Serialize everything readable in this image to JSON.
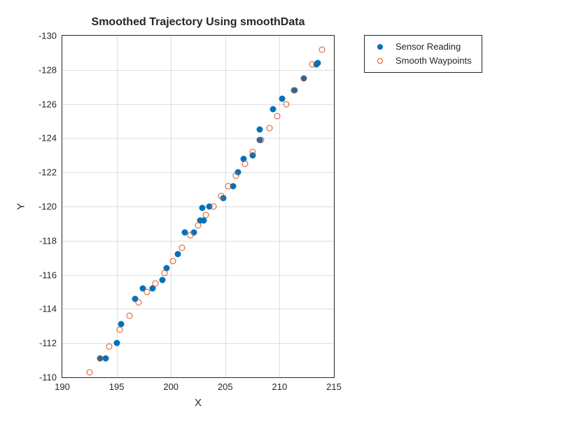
{
  "chart_data": {
    "type": "scatter",
    "title": "Smoothed Trajectory Using smoothData",
    "xlabel": "X",
    "ylabel": "Y",
    "xlim": [
      190,
      215
    ],
    "ylim": [
      -110,
      -130
    ],
    "xticks": [
      190,
      195,
      200,
      205,
      210,
      215
    ],
    "yticks": [
      -110,
      -112,
      -114,
      -116,
      -118,
      -120,
      -122,
      -124,
      -126,
      -128,
      -130
    ],
    "grid": true,
    "legend_position": "outside-right-top",
    "series": [
      {
        "name": "Sensor Reading",
        "marker": "filled-circle",
        "color": "#0072BD",
        "points": [
          [
            193.5,
            -111.1
          ],
          [
            194.0,
            -111.1
          ],
          [
            195.0,
            -112.0
          ],
          [
            195.4,
            -113.1
          ],
          [
            196.7,
            -114.6
          ],
          [
            197.4,
            -115.2
          ],
          [
            198.3,
            -115.2
          ],
          [
            199.2,
            -115.7
          ],
          [
            199.6,
            -116.4
          ],
          [
            200.6,
            -117.2
          ],
          [
            201.3,
            -118.5
          ],
          [
            202.1,
            -118.5
          ],
          [
            202.7,
            -119.2
          ],
          [
            202.9,
            -119.9
          ],
          [
            203.0,
            -119.2
          ],
          [
            203.5,
            -120.0
          ],
          [
            204.8,
            -120.5
          ],
          [
            205.7,
            -121.2
          ],
          [
            206.2,
            -122.0
          ],
          [
            206.7,
            -122.8
          ],
          [
            207.5,
            -123.0
          ],
          [
            208.2,
            -123.9
          ],
          [
            208.2,
            -124.5
          ],
          [
            209.4,
            -125.7
          ],
          [
            210.2,
            -126.3
          ],
          [
            211.3,
            -126.8
          ],
          [
            212.2,
            -127.5
          ],
          [
            213.4,
            -128.3
          ],
          [
            213.5,
            -128.4
          ]
        ]
      },
      {
        "name": "Smooth Waypoints",
        "marker": "open-circle",
        "color": "#D95319",
        "points": [
          [
            192.5,
            -110.3
          ],
          [
            193.5,
            -111.1
          ],
          [
            194.3,
            -111.8
          ],
          [
            195.3,
            -112.8
          ],
          [
            196.2,
            -113.6
          ],
          [
            197.0,
            -114.4
          ],
          [
            197.8,
            -115.0
          ],
          [
            198.6,
            -115.5
          ],
          [
            199.4,
            -116.1
          ],
          [
            200.2,
            -116.8
          ],
          [
            201.0,
            -117.6
          ],
          [
            201.8,
            -118.3
          ],
          [
            202.5,
            -118.9
          ],
          [
            203.2,
            -119.5
          ],
          [
            203.9,
            -120.0
          ],
          [
            204.6,
            -120.6
          ],
          [
            205.3,
            -121.2
          ],
          [
            206.0,
            -121.8
          ],
          [
            206.8,
            -122.5
          ],
          [
            207.5,
            -123.2
          ],
          [
            208.3,
            -123.9
          ],
          [
            209.1,
            -124.6
          ],
          [
            209.8,
            -125.3
          ],
          [
            210.6,
            -126.0
          ],
          [
            211.4,
            -126.8
          ],
          [
            212.2,
            -127.5
          ],
          [
            213.0,
            -128.3
          ],
          [
            213.9,
            -129.2
          ]
        ]
      }
    ]
  }
}
